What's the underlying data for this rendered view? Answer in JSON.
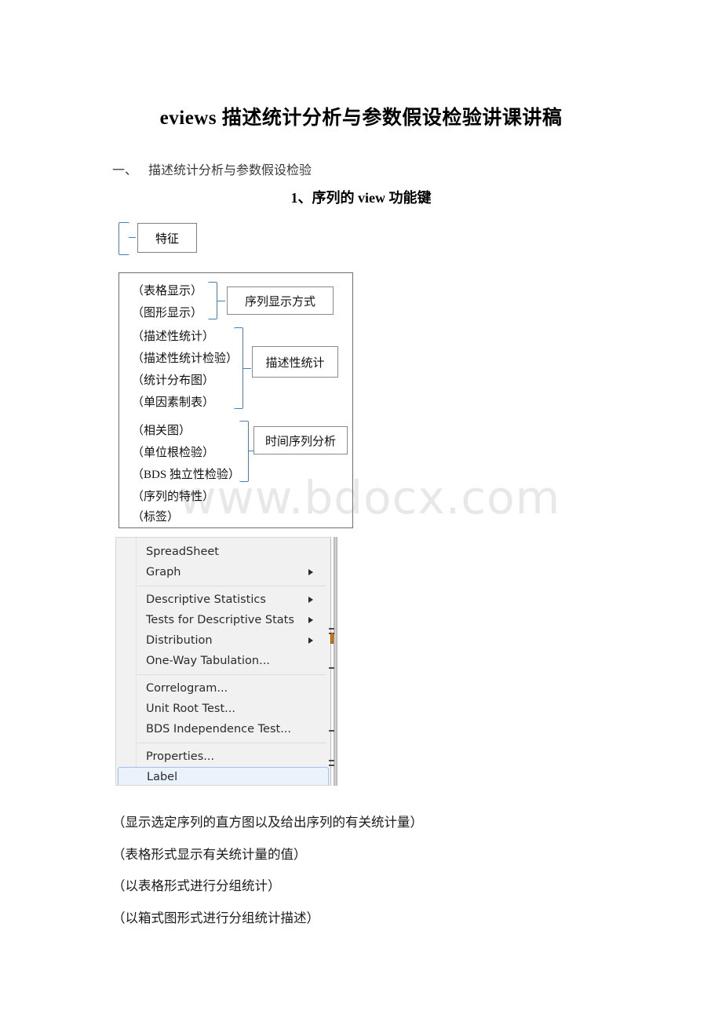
{
  "document": {
    "title": "eviews 描述统计分析与参数假设检验讲课讲稿",
    "section": {
      "number": "一、",
      "text": "描述统计分析与参数假设检验"
    },
    "subheading": "1、序列的 view 功能键",
    "watermark": "www.bdocx.com"
  },
  "diagram": {
    "feature_box": "特征",
    "groups": [
      {
        "items": [
          "（表格显示）",
          "（图形显示）"
        ],
        "box": "序列显示方式"
      },
      {
        "items": [
          "（描述性统计）",
          "（描述性统计检验）",
          "（统计分布图）",
          "（单因素制表）"
        ],
        "box": "描述性统计"
      },
      {
        "items": [
          "（相关图）",
          "（单位根检验）",
          "（BDS 独立性检验）"
        ],
        "box": "时间序列分析"
      }
    ],
    "loose_items": [
      "（序列的特性）",
      "（标签）"
    ]
  },
  "context_menu": {
    "items": [
      {
        "label": "SpreadSheet",
        "submenu": false,
        "selected": false
      },
      {
        "label": "Graph",
        "submenu": true,
        "selected": false
      },
      {
        "separator": true
      },
      {
        "label": "Descriptive Statistics",
        "submenu": true,
        "selected": false
      },
      {
        "label": "Tests for Descriptive Stats",
        "submenu": true,
        "selected": false
      },
      {
        "label": "Distribution",
        "submenu": true,
        "selected": false
      },
      {
        "label": "One-Way Tabulation...",
        "submenu": false,
        "selected": false
      },
      {
        "separator": true
      },
      {
        "label": "Correlogram...",
        "submenu": false,
        "selected": false
      },
      {
        "label": "Unit Root Test...",
        "submenu": false,
        "selected": false
      },
      {
        "label": "BDS Independence Test...",
        "submenu": false,
        "selected": false
      },
      {
        "separator": true
      },
      {
        "label": "Properties...",
        "submenu": false,
        "selected": false
      },
      {
        "label": "Label",
        "submenu": false,
        "selected": true
      }
    ],
    "highlight_color": "#eaf2fb"
  },
  "notes": [
    "（显示选定序列的直方图以及给出序列的有关统计量）",
    "（表格形式显示有关统计量的值）",
    "（以表格形式进行分组统计）",
    "（以箱式图形式进行分组统计描述）"
  ]
}
